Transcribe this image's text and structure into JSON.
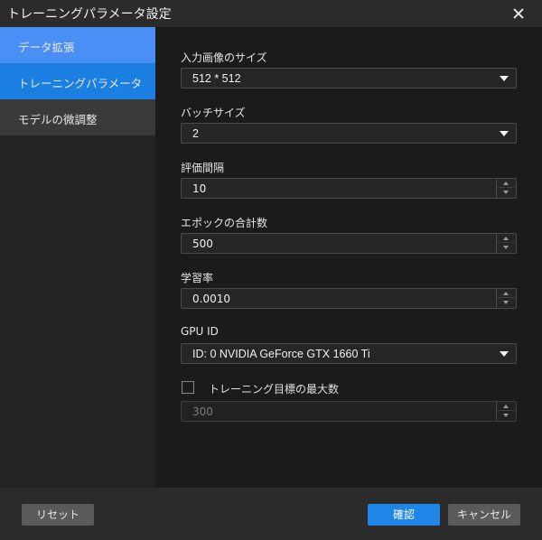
{
  "window": {
    "title": "トレーニングパラメータ設定"
  },
  "sidebar": {
    "items": [
      {
        "label": "データ拡張"
      },
      {
        "label": "トレーニングパラメータ"
      },
      {
        "label": "モデルの微調整"
      }
    ]
  },
  "form": {
    "input_size": {
      "label": "入力画像のサイズ",
      "value": "512 * 512"
    },
    "batch_size": {
      "label": "バッチサイズ",
      "value": "2"
    },
    "eval_interval": {
      "label": "評価間隔",
      "value": "10"
    },
    "epochs": {
      "label": "エポックの合計数",
      "value": "500"
    },
    "learning_rate": {
      "label": "学習率",
      "value": "0.0010"
    },
    "gpu": {
      "label": "GPU ID",
      "value": "ID: 0  NVIDIA GeForce GTX 1660 Ti"
    },
    "max_target": {
      "label": "トレーニング目標の最大数",
      "checked": false,
      "value": "300"
    }
  },
  "footer": {
    "reset_label": "リセット",
    "ok_label": "確認",
    "cancel_label": "キャンセル"
  },
  "colors": {
    "accent": "#1f86e8",
    "sidebar_active": "#1a7fe0",
    "sidebar_hover": "#4a8ff5"
  }
}
